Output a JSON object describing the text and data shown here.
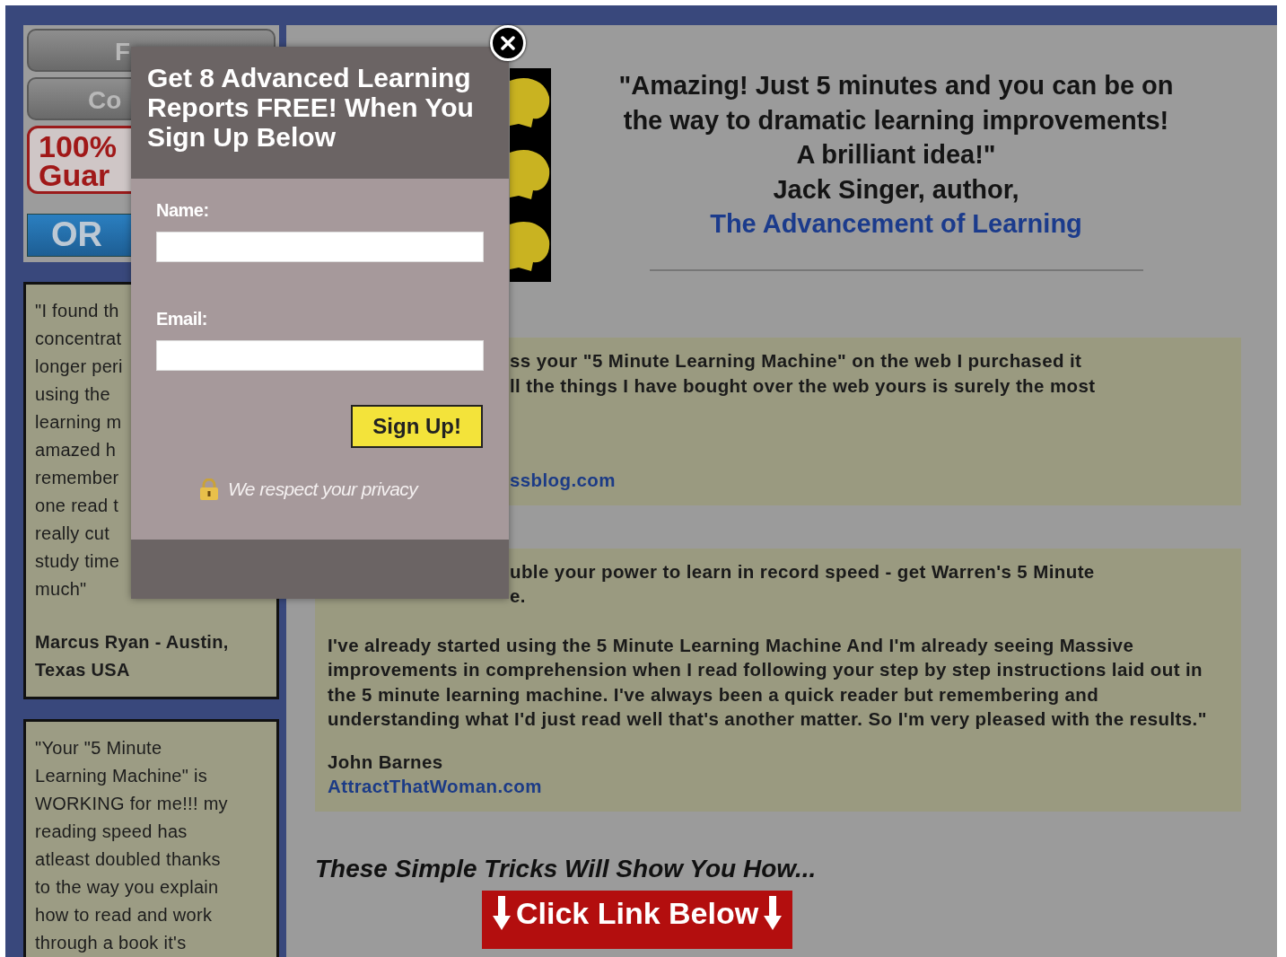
{
  "sidebar": {
    "nav": [
      {
        "kind": "grey",
        "label": "F"
      },
      {
        "kind": "grey",
        "label": "Co"
      },
      {
        "kind": "badge",
        "label": "100%\nGuar"
      },
      {
        "kind": "blue",
        "label": "OR"
      }
    ],
    "testimonials": [
      {
        "text": "\"I found th\nconcentrat\nlonger peri\nusing the\nlearning m\namazed h\nremember\none read t\nreally cut\nstudy time\nmuch\"",
        "author": "Marcus Ryan - Austin,\nTexas USA"
      },
      {
        "text": "\"Your \"5 Minute\nLearning Machine\" is\nWORKING for me!!! my\nreading speed has\natleast doubled thanks\nto the way you explain\nhow to read and work\nthrough a book it's"
      }
    ]
  },
  "headline": {
    "quote": "\"Amazing! Just 5 minutes and you can be on\nthe way to dramatic learning improvements!\nA brilliant idea!\"\nJack Singer, author,",
    "link": "The Advancement of Learning"
  },
  "testimonials": [
    {
      "partial": [
        "ss your \"5 Minute Learning Machine\" on the web I purchased it",
        "ll the things I have bought over the web yours is surely the most"
      ],
      "link": "ssblog.com"
    },
    {
      "partial": [
        "uble your power to learn in record speed - get Warren's 5 Minute",
        "e."
      ],
      "text": "I've already started using the 5 Minute Learning Machine And I'm already seeing Massive improvements in comprehension when I read following your step by step instructions laid out in the 5 minute learning machine. I've always been a quick reader but remembering and understanding what I'd just read well that's another matter. So I'm very pleased with the results.\"",
      "author": "John Barnes",
      "link": "AttractThatWoman.com"
    }
  ],
  "tricks": "These Simple Tricks Will Show You How...",
  "banner": "Click Link Below",
  "popup": {
    "title": "Get 8 Advanced Learning Reports FREE! When You Sign Up Below",
    "fields": [
      {
        "label": "Name:"
      },
      {
        "label": "Email:"
      }
    ],
    "submit": "Sign Up!",
    "privacy": "We respect your privacy"
  }
}
